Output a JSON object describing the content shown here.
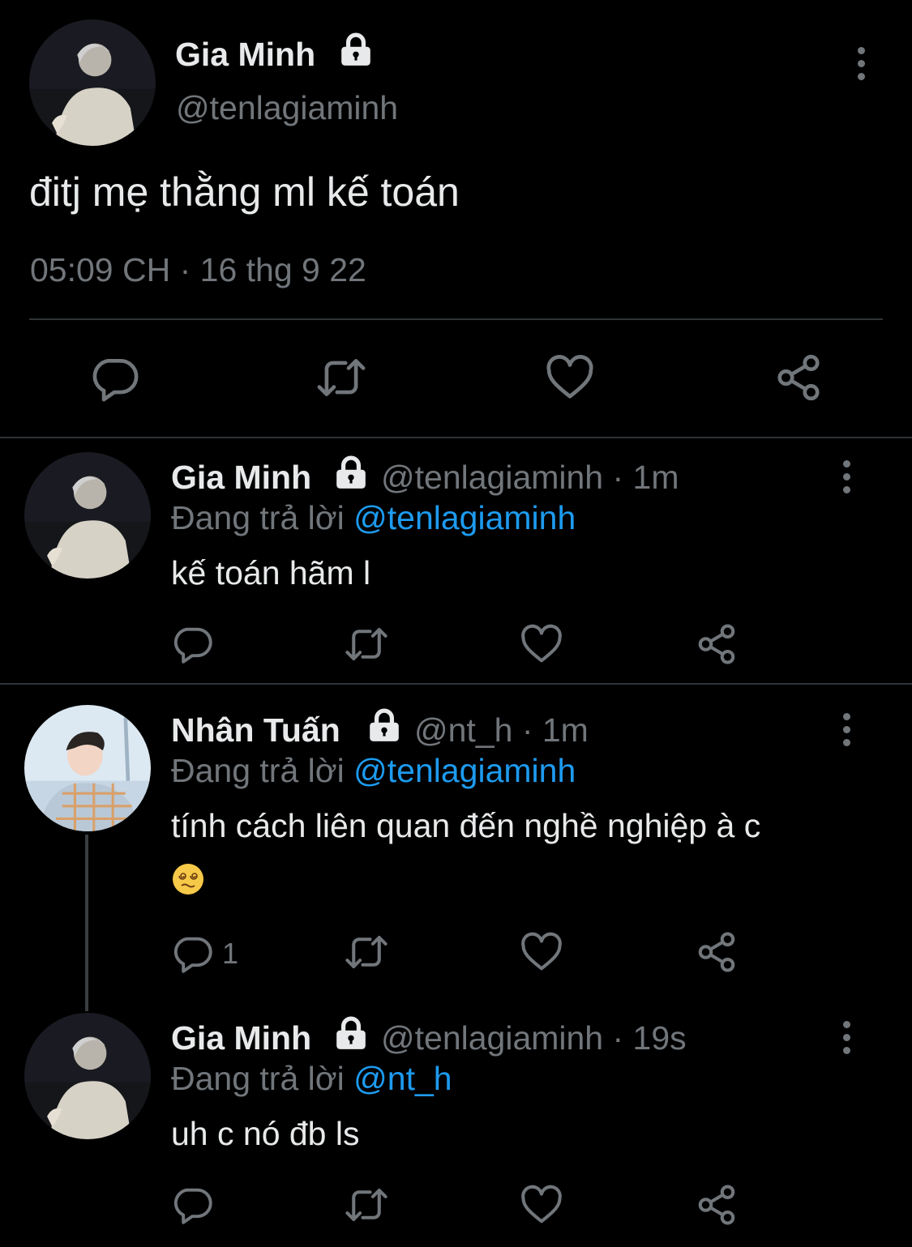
{
  "main_tweet": {
    "name": "Gia Minh",
    "handle": "@tenlagiaminh",
    "text": "đitj mẹ thằng ml kế toán",
    "timestamp": "05:09 CH · 16 thg 9 22"
  },
  "replies": [
    {
      "name": "Gia Minh",
      "handle": "@tenlagiaminh",
      "time": "· 1m",
      "replying_label": "Đang trả lời",
      "replying_to": "@tenlagiaminh",
      "text": "kế toán hãm l",
      "reply_count": ""
    },
    {
      "name": "Nhân Tuấn",
      "handle": "@nt_h",
      "time": "· 1m",
      "replying_label": "Đang trả lời",
      "replying_to": "@tenlagiaminh",
      "text": "tính cách liên quan đến nghề nghiệp à c",
      "emoji": "😵‍💫",
      "reply_count": "1"
    },
    {
      "name": "Gia Minh",
      "handle": "@tenlagiaminh",
      "time": "· 19s",
      "replying_label": "Đang trả lời",
      "replying_to": "@nt_h",
      "text": "uh c nó đb ls",
      "reply_count": ""
    }
  ],
  "colors": {
    "background": "#000000",
    "text": "#e7e9ea",
    "muted": "#71767b",
    "link": "#1d9bf0",
    "divider": "#2f3336"
  },
  "icons": [
    "lock-icon",
    "more-icon",
    "reply-icon",
    "retweet-icon",
    "like-icon",
    "share-icon"
  ]
}
